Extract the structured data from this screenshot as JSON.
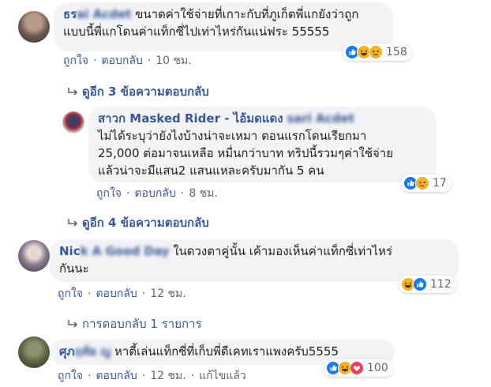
{
  "comments": [
    {
      "author": "ธร",
      "author_blurred": "ai Acdet",
      "lines": [
        "ขนาดค่าใช้จ่ายที่เกาะกับที่ภูเก็ตพี่แกยังว่าถูก",
        "แบบนี้พี่แกโดนค่าแท็กซี่ไปเท่าไหร่กันแน่ฟระ 55555"
      ],
      "like": "ถูกใจ",
      "reply": "ตอบกลับ",
      "time": "10 ชม.",
      "reaction_count": "158",
      "reactions": [
        "like-icon",
        "haha-icon",
        "sad-icon"
      ]
    },
    {
      "replies_link": "ดูอีก 3 ข้อความตอบกลับ"
    },
    {
      "author": "สาวก Masked Rider - ไอ้มดแดง",
      "author_blurred": "sari Acdet",
      "lines": [
        "ไม่ได้ระบุว่ายังไงบ้างน่าจะเหมา ตอนแรกโดนเรียกมา",
        "25,000 ต่อมาจนเหลือ หมื่นกว่าบาท ทริปนี้รวมๆค่าใช้จ่าย",
        "แล้วน่าจะมีแสน2 แสนแหละครับมากัน 5 คน"
      ],
      "like": "ถูกใจ",
      "reply": "ตอบกลับ",
      "time": "8 ชม.",
      "reaction_count": "17",
      "reactions": [
        "like-icon",
        "sad-icon"
      ]
    },
    {
      "replies_link": "ดูอีก 4 ข้อความตอบกลับ"
    },
    {
      "author": "Nic",
      "author_blurred": "k A Good Day",
      "lines": [
        "ในดวงตาคู่นั้น เค้ามองเห็นค่าแท็กซี่เท่าไหร่",
        "กันนะ"
      ],
      "like": "ถูกใจ",
      "reply": "ตอบกลับ",
      "time": "12 ชม.",
      "reaction_count": "112",
      "reactions": [
        "haha-icon",
        "like-icon"
      ]
    },
    {
      "replies_link": "การตอบกลับ 1 รายการ"
    },
    {
      "author": "ศุภ",
      "author_blurred": "ฤทัย ญ",
      "lines": [
        "หาตี้เล่นแท็กซี่ที่เก็บพี่ดีเคทเราแพงครับ5555"
      ],
      "like": "ถูกใจ",
      "reply": "ตอบกลับ",
      "time": "12 ชม.",
      "edited": "แก้ไขแล้ว",
      "reaction_count": "100",
      "reactions": [
        "like-icon",
        "haha-icon",
        "love-icon"
      ]
    }
  ],
  "colors": {
    "link": "#385898",
    "meta": "#606770",
    "bubble": "#f2f3f5"
  }
}
